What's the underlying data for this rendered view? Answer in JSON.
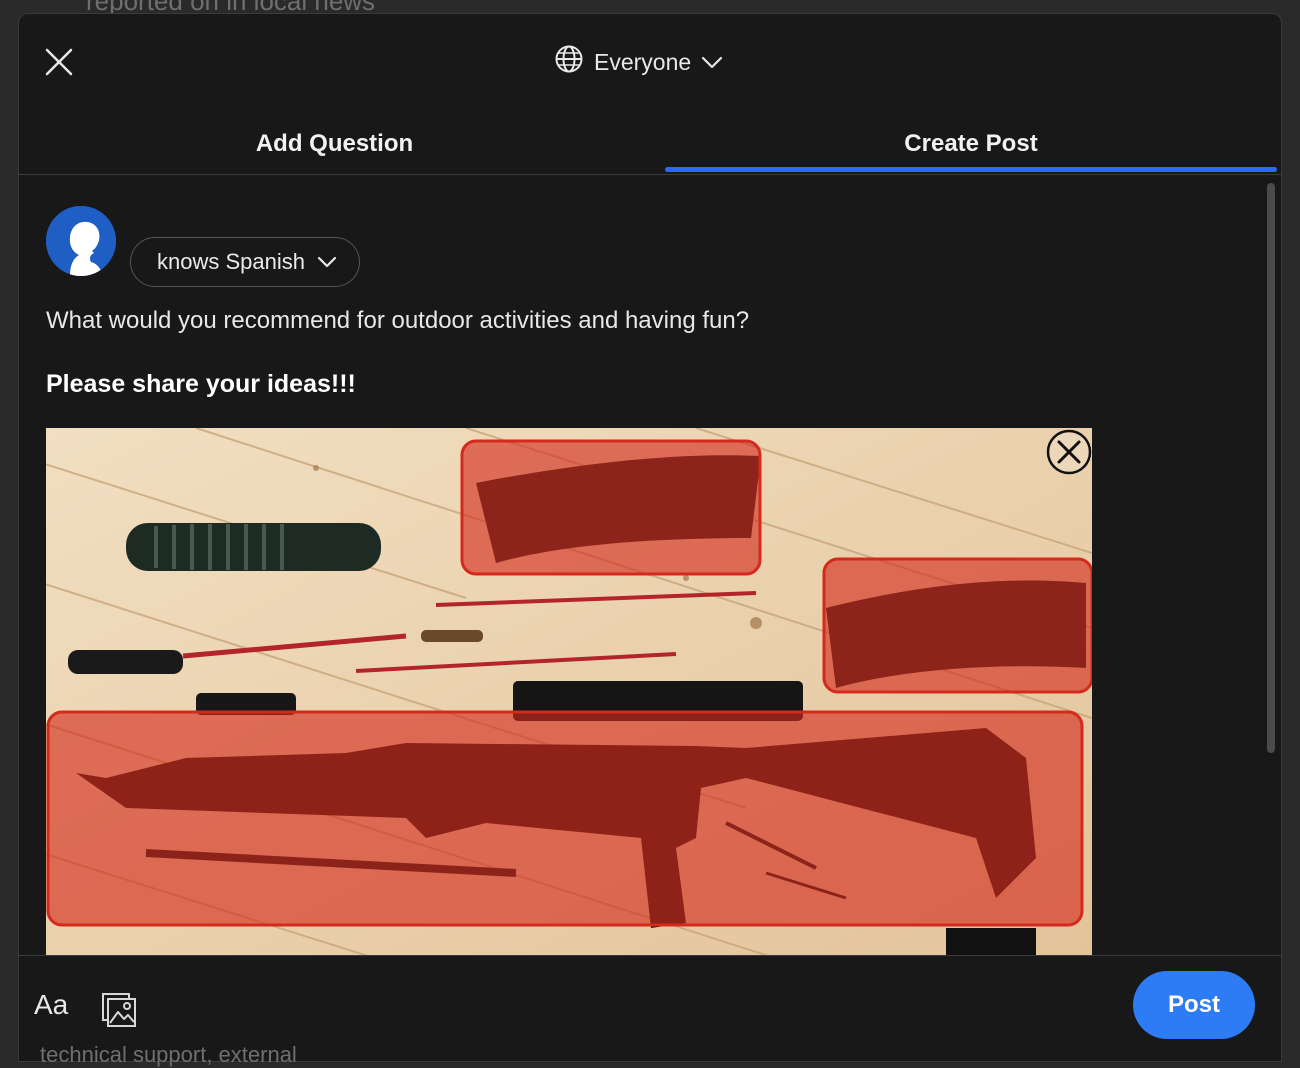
{
  "background": {
    "top_text": "reported on in local news",
    "bottom_text": "technical support, external"
  },
  "header": {
    "audience_label": "Everyone"
  },
  "tabs": [
    {
      "label": "Add Question",
      "active": false
    },
    {
      "label": "Create Post",
      "active": true
    }
  ],
  "post": {
    "credential": "knows Spanish",
    "question": "What would you recommend for outdoor activities and having fun?",
    "prompt": "Please share your ideas!!!"
  },
  "footer": {
    "text_format_label": "Aa",
    "post_button": "Post"
  },
  "colors": {
    "accent": "#2e69ff",
    "post_button": "#2e7bf6",
    "highlight": "#d42a1c",
    "modal_bg": "#181819"
  }
}
